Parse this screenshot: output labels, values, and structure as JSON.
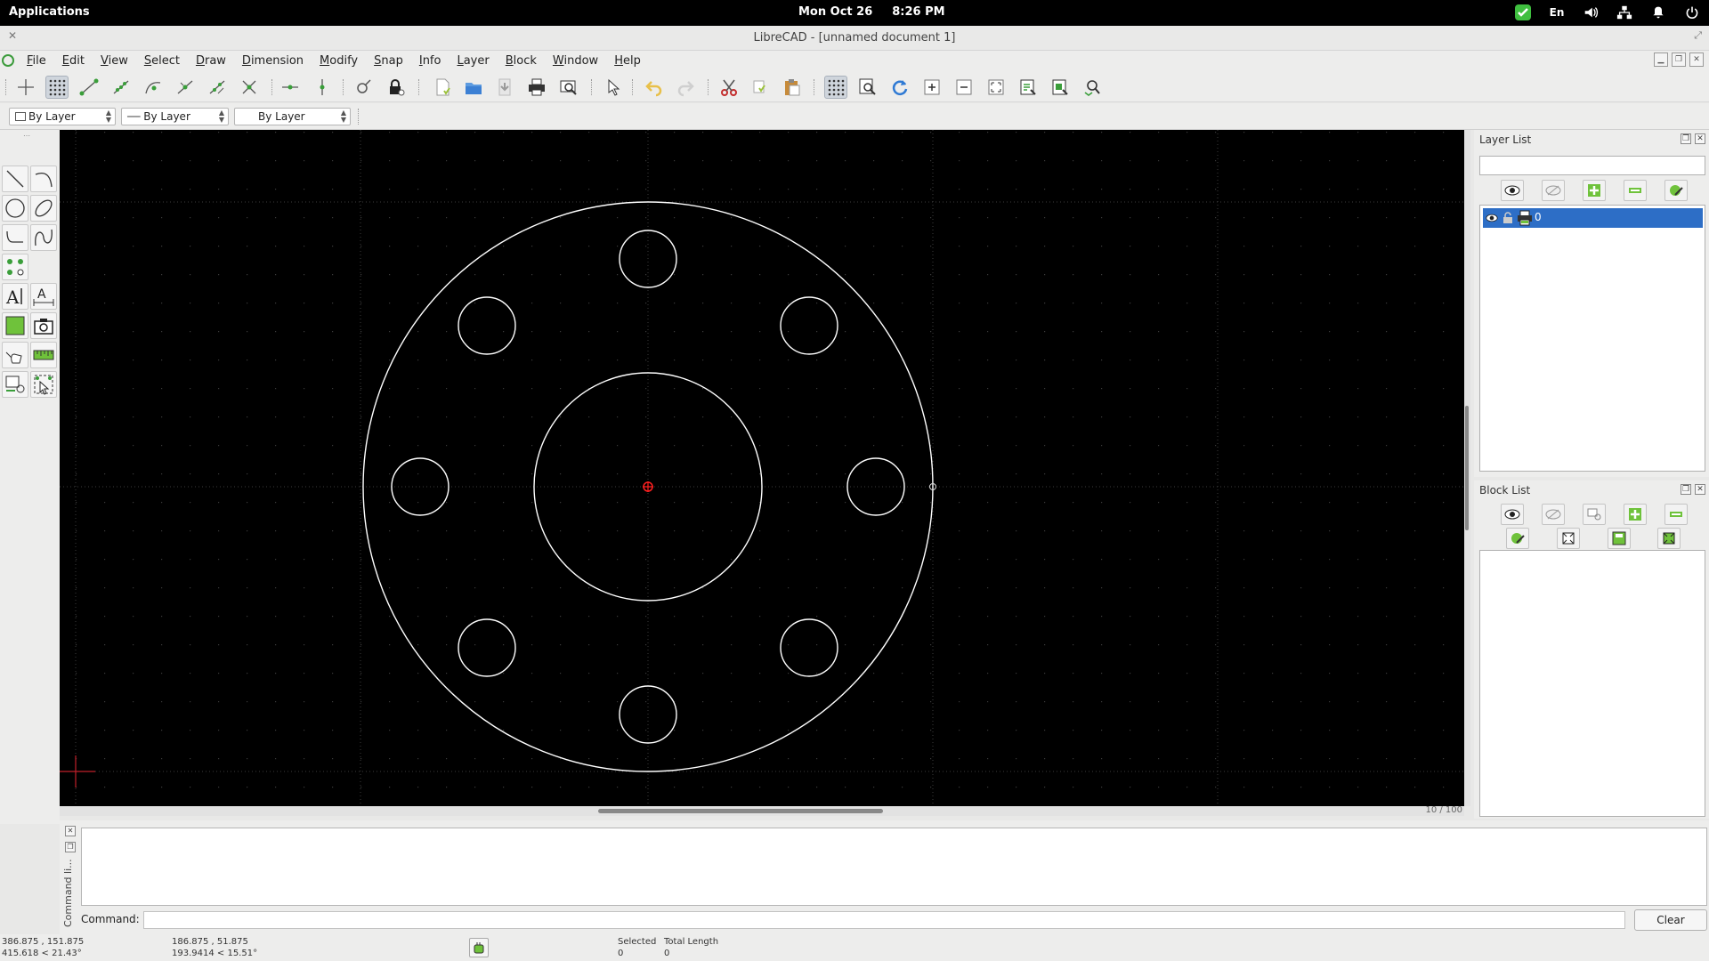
{
  "topbar": {
    "apps": "Applications",
    "date": "Mon Oct 26",
    "time": "8:26 PM",
    "lang": "En"
  },
  "window": {
    "title": "LibreCAD - [unnamed document 1]"
  },
  "menu": [
    "File",
    "Edit",
    "View",
    "Select",
    "Draw",
    "Dimension",
    "Modify",
    "Snap",
    "Info",
    "Layer",
    "Block",
    "Window",
    "Help"
  ],
  "pen": {
    "color": "By Layer",
    "line_type": "By Layer",
    "line_width": "By Layer"
  },
  "layers": {
    "title": "Layer List",
    "filter_value": "",
    "items": [
      {
        "name": "0"
      }
    ]
  },
  "blocks": {
    "title": "Block List"
  },
  "command": {
    "dock_label": "Command li...",
    "label": "Command:",
    "value": "",
    "clear": "Clear"
  },
  "status": {
    "abs1": "386.875 , 151.875",
    "abs2": "415.618 < 21.43°",
    "rel1": "186.875 , 51.875",
    "rel2": "193.9414 < 15.51°",
    "selected_label": "Selected",
    "selected_value": "0",
    "length_label": "Total Length",
    "length_value": "0"
  },
  "scroll": {
    "zoom_text": "10 / 100"
  },
  "colors": {
    "accent": "#2d6ec6",
    "canvas": "#000000",
    "drawing": "#ffffff",
    "origin": "#ff2020"
  }
}
